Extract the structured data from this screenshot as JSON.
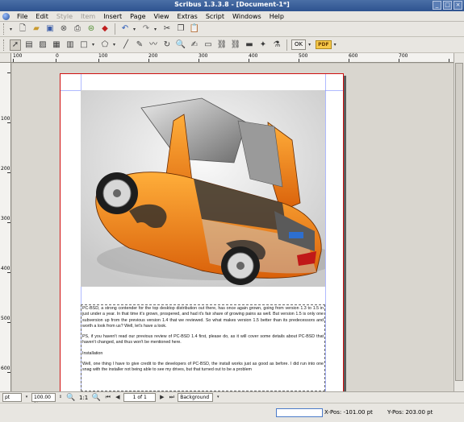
{
  "window": {
    "title": "Scribus 1.3.3.8 - [Document-1*]"
  },
  "menu": {
    "items": [
      {
        "label": "File",
        "enabled": true
      },
      {
        "label": "Edit",
        "enabled": true
      },
      {
        "label": "Style",
        "enabled": false
      },
      {
        "label": "Item",
        "enabled": false
      },
      {
        "label": "Insert",
        "enabled": true
      },
      {
        "label": "Page",
        "enabled": true
      },
      {
        "label": "View",
        "enabled": true
      },
      {
        "label": "Extras",
        "enabled": true
      },
      {
        "label": "Script",
        "enabled": true
      },
      {
        "label": "Windows",
        "enabled": true
      },
      {
        "label": "Help",
        "enabled": true
      }
    ]
  },
  "toolbar2": {
    "ok_label": "OK",
    "pdf_label": "PDF"
  },
  "ruler": {
    "h_labels": [
      "100",
      "0",
      "100",
      "200",
      "300",
      "400",
      "500",
      "600",
      "700"
    ],
    "v_labels": [
      "100",
      "200",
      "300",
      "400",
      "500",
      "600"
    ]
  },
  "document": {
    "paragraphs": [
      "PC-BSD, a strong contender for the top desktop distribution out there, has once again grown, going from version 1.3 to 1.5 in just under a year. In that time it's grown, prospered, and had it's fair share of growing pains as well. But version 1.5 is only one subversion up from the previous version 1.4 that we reviewed. So what makes version 1.5 better than its predecessors and worth a look from us? Well, let's have a look.",
      "PS, if you haven't read our previous review of PC-BSD 1.4 first, please do, as it will cover some details about PC-BSD that haven't changed, and thus won't be mentioned here.",
      "Installation",
      "Well, one thing I have to give credit to the developers of PC-BSD, the install works just as good as before. I did run into one snag with the installer not being able to see my drives, but that turned out to be a problem"
    ]
  },
  "status": {
    "unit": "pt",
    "zoom": "100.00 %",
    "ratio": "1:1",
    "page": "1 of 1",
    "layer": "Background",
    "xpos": "X-Pos: -101.00 pt",
    "ypos": "Y-Pos: 203.00 pt"
  }
}
